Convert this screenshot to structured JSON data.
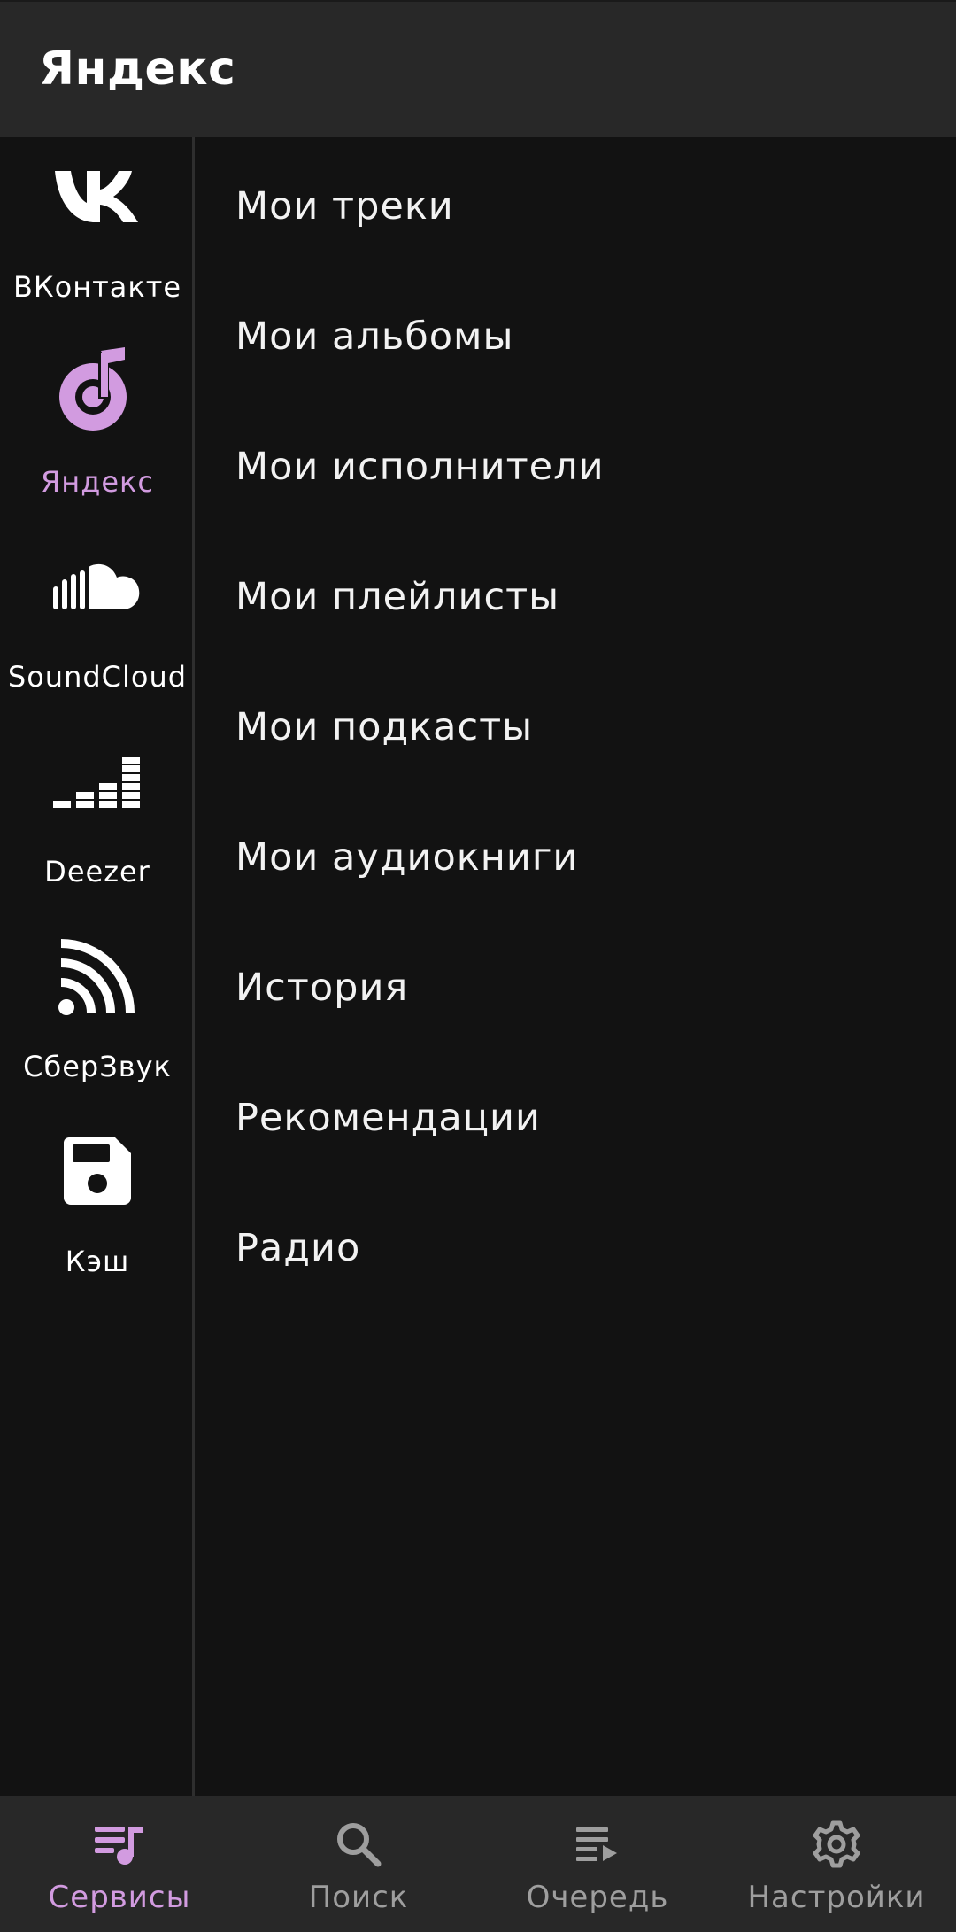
{
  "header": {
    "title": "Яндекс"
  },
  "sidebar": {
    "items": [
      {
        "label": "ВКонтакте",
        "icon": "vk-logo-icon",
        "active": false
      },
      {
        "label": "Яндекс",
        "icon": "music-note-icon",
        "active": true
      },
      {
        "label": "SoundCloud",
        "icon": "soundcloud-logo-icon",
        "active": false
      },
      {
        "label": "Deezer",
        "icon": "equalizer-icon",
        "active": false
      },
      {
        "label": "СберЗвук",
        "icon": "broadcast-icon",
        "active": false
      },
      {
        "label": "Кэш",
        "icon": "save-disk-icon",
        "active": false
      }
    ]
  },
  "menu": {
    "items": [
      "Мои треки",
      "Мои альбомы",
      "Мои исполнители",
      "Мои плейлисты",
      "Мои подкасты",
      "Мои аудиокниги",
      "История",
      "Рекомендации",
      "Радио"
    ]
  },
  "bottom_nav": {
    "items": [
      {
        "label": "Сервисы",
        "icon": "library-music-icon",
        "active": true
      },
      {
        "label": "Поиск",
        "icon": "search-icon",
        "active": false
      },
      {
        "label": "Очередь",
        "icon": "queue-icon",
        "active": false
      },
      {
        "label": "Настройки",
        "icon": "gear-icon",
        "active": false
      }
    ]
  },
  "colors": {
    "accent": "#d29be0",
    "background": "#121212",
    "bar": "#282828",
    "inactive_nav": "#9e9e9e"
  }
}
